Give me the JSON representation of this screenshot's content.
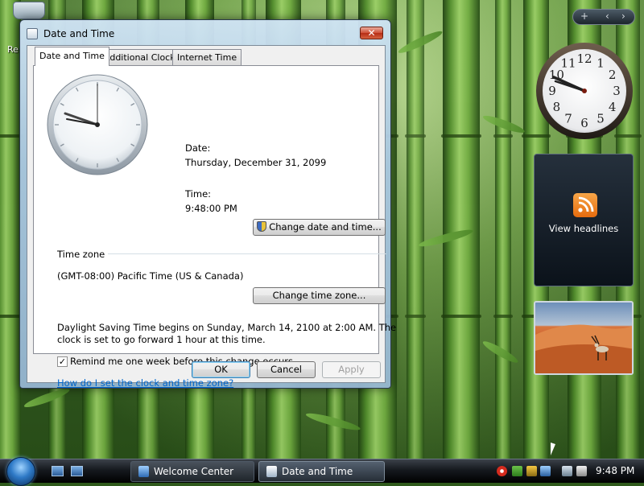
{
  "desktop": {
    "recycle_bin_label": "Re"
  },
  "dialog": {
    "title": "Date and Time",
    "close_glyph": "✕",
    "tabs": [
      {
        "label": "Date and Time",
        "active": true
      },
      {
        "label": "Additional Clocks",
        "active": false
      },
      {
        "label": "Internet Time",
        "active": false
      }
    ],
    "date_label": "Date:",
    "date_value": "Thursday, December 31, 2099",
    "time_label": "Time:",
    "time_value": "9:48:00 PM",
    "change_date_button": "Change date and time...",
    "timezone_header": "Time zone",
    "timezone_value": "(GMT-08:00) Pacific Time (US & Canada)",
    "change_tz_button": "Change time zone...",
    "dst_line1": "Daylight Saving Time begins on Sunday, March 14, 2100 at 2:00 AM. The",
    "dst_line2": "clock is set to go forward 1 hour at this time.",
    "remind_checked": true,
    "remind_label": "Remind me one week before this change occurs",
    "help_link": "How do I set the clock and time zone?",
    "ok_button": "OK",
    "cancel_button": "Cancel",
    "apply_button": "Apply",
    "apply_disabled": true
  },
  "sidebar": {
    "controls": {
      "add": "+",
      "prev": "‹",
      "next": "›"
    },
    "clock_numbers": [
      "12",
      "1",
      "2",
      "3",
      "4",
      "5",
      "6",
      "7",
      "8",
      "9",
      "10",
      "11"
    ],
    "feed_label": "View headlines"
  },
  "taskbar": {
    "items": [
      {
        "label": "Welcome Center",
        "active": false
      },
      {
        "label": "Date and Time",
        "active": true
      }
    ],
    "clock": "9:48 PM"
  },
  "colors": {
    "link": "#0066cc",
    "rss": "#e66b0e",
    "close_button": "#c9462c"
  }
}
